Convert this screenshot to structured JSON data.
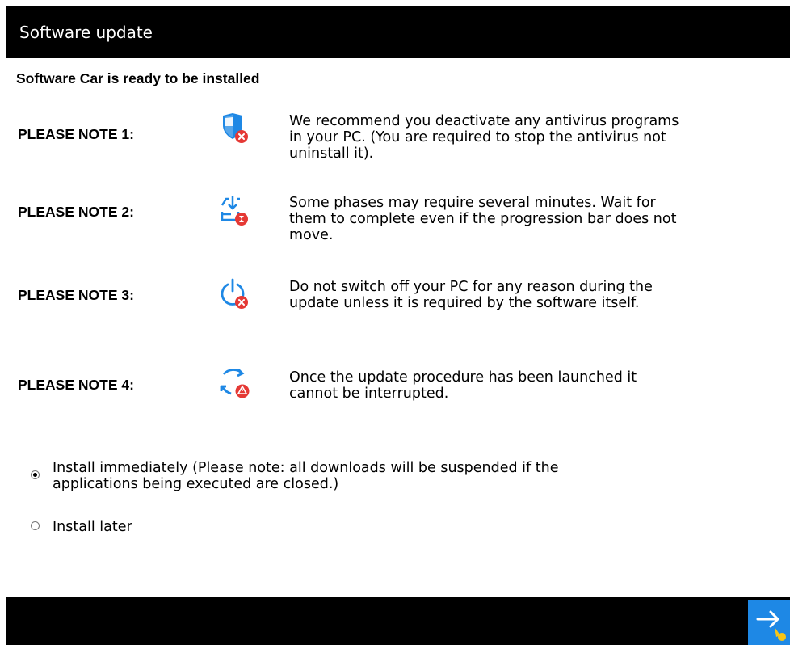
{
  "window": {
    "title": "Software update"
  },
  "header": {
    "subtitle": "Software Car is ready to be installed"
  },
  "notes": [
    {
      "label": "PLEASE NOTE 1:",
      "icon": "shield-error-icon",
      "lines": [
        "We recommend you deactivate any antivirus programs",
        "in your PC. (You are required to stop the antivirus not",
        "uninstall it)."
      ]
    },
    {
      "label": "PLEASE NOTE 2:",
      "icon": "download-wait-icon",
      "lines": [
        "Some phases may require several minutes. Wait for",
        "them to complete even if the progression bar does not",
        "move."
      ]
    },
    {
      "label": "PLEASE NOTE 3:",
      "icon": "power-error-icon",
      "lines": [
        "Do not switch off your PC for any reason during the",
        "update unless it is required by the software itself."
      ]
    },
    {
      "label": "PLEASE NOTE 4:",
      "icon": "refresh-warning-icon",
      "lines": [
        "Once the update procedure has been launched it",
        "cannot be interrupted."
      ]
    }
  ],
  "options": {
    "selected": "install_immediately",
    "install_immediately": {
      "lines": [
        "Install immediately (Please note: all downloads will be suspended if the",
        "applications being  executed are closed.)"
      ]
    },
    "install_later": {
      "label": "Install later"
    }
  },
  "colors": {
    "titlebar": "#000000",
    "icon_blue": "#1e88e5",
    "icon_red": "#e53935",
    "next_button": "#1e88e5",
    "next_accent": "#f5c518"
  }
}
